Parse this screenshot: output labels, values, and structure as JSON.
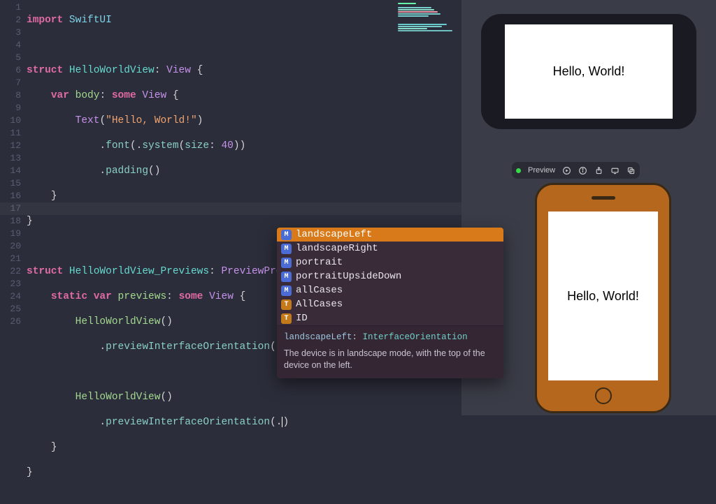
{
  "gutter": {
    "lines": [
      "1",
      "2",
      "3",
      "4",
      "5",
      "6",
      "7",
      "8",
      "9",
      "10",
      "11",
      "12",
      "13",
      "14",
      "15",
      "16",
      "17",
      "18",
      "19",
      "20",
      "21",
      "22",
      "23",
      "24",
      "25",
      "26"
    ]
  },
  "code": {
    "import": "import",
    "swiftui": "SwiftUI",
    "struct": "struct",
    "view1_name": "HelloWorldView",
    "view_proto": "View",
    "var": "var",
    "body": "body",
    "some": "some",
    "text": "Text",
    "str": "\"Hello, World!\"",
    "font": "font",
    "system": "system",
    "size_label": "size",
    "size_val": "40",
    "padding": "padding",
    "view2_name": "HelloWorldView_Previews",
    "preview_proto": "PreviewProvider",
    "static": "static",
    "previews": "previews",
    "previewifo": "previewInterfaceOrientation",
    "landscapeLeft": "landscapeLeft"
  },
  "preview_text": "Hello, World!",
  "toolbar": {
    "label": "Preview"
  },
  "autocomplete": {
    "items": [
      {
        "icon": "M",
        "label": "landscapeLeft"
      },
      {
        "icon": "M",
        "label": "landscapeRight"
      },
      {
        "icon": "M",
        "label": "portrait"
      },
      {
        "icon": "M",
        "label": "portraitUpsideDown"
      },
      {
        "icon": "M",
        "label": "allCases"
      },
      {
        "icon": "T",
        "label": "AllCases"
      },
      {
        "icon": "T",
        "label": "ID"
      }
    ],
    "doc_sig_name": "landscapeLeft",
    "doc_sig_type": "InterfaceOrientation",
    "doc_body": "The device is in landscape mode, with the top of the device on the left."
  }
}
